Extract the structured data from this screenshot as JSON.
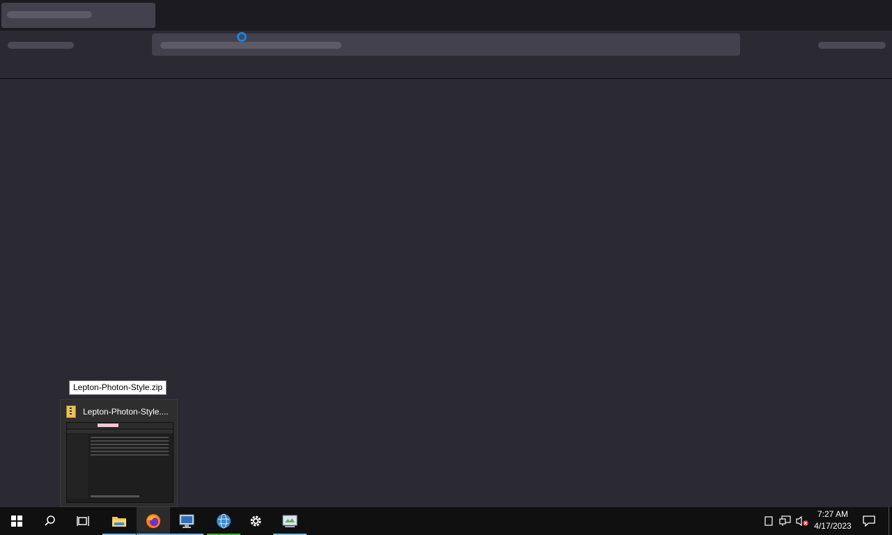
{
  "tooltip": {
    "text": "Lepton-Photon-Style.zip"
  },
  "thumbnail": {
    "title": "Lepton-Photon-Style...."
  },
  "taskbar": {
    "items": [
      {
        "name": "start-button",
        "icon": "windows-logo-icon"
      },
      {
        "name": "search-button",
        "icon": "search-icon"
      },
      {
        "name": "task-view-button",
        "icon": "task-view-icon"
      },
      {
        "name": "file-explorer-button",
        "icon": "folder-icon"
      },
      {
        "name": "firefox-button",
        "icon": "firefox-icon"
      },
      {
        "name": "remote-desktop-button",
        "icon": "monitor-icon"
      },
      {
        "name": "network-globe-button",
        "icon": "globe-icon"
      },
      {
        "name": "settings-button",
        "icon": "gear-icon"
      },
      {
        "name": "control-panel-button",
        "icon": "control-panel-icon"
      }
    ],
    "tray": {
      "icons": [
        "notes-icon",
        "network-icon",
        "volume-muted-icon",
        "notification-icon"
      ]
    },
    "clock": {
      "time": "7:27 AM",
      "date": "4/17/2023"
    }
  },
  "colors": {
    "browser_bg": "#2b2a33",
    "tabbar_bg": "#1c1b22",
    "accent": "#76b9ed",
    "taskbar_bg": "#101010"
  }
}
